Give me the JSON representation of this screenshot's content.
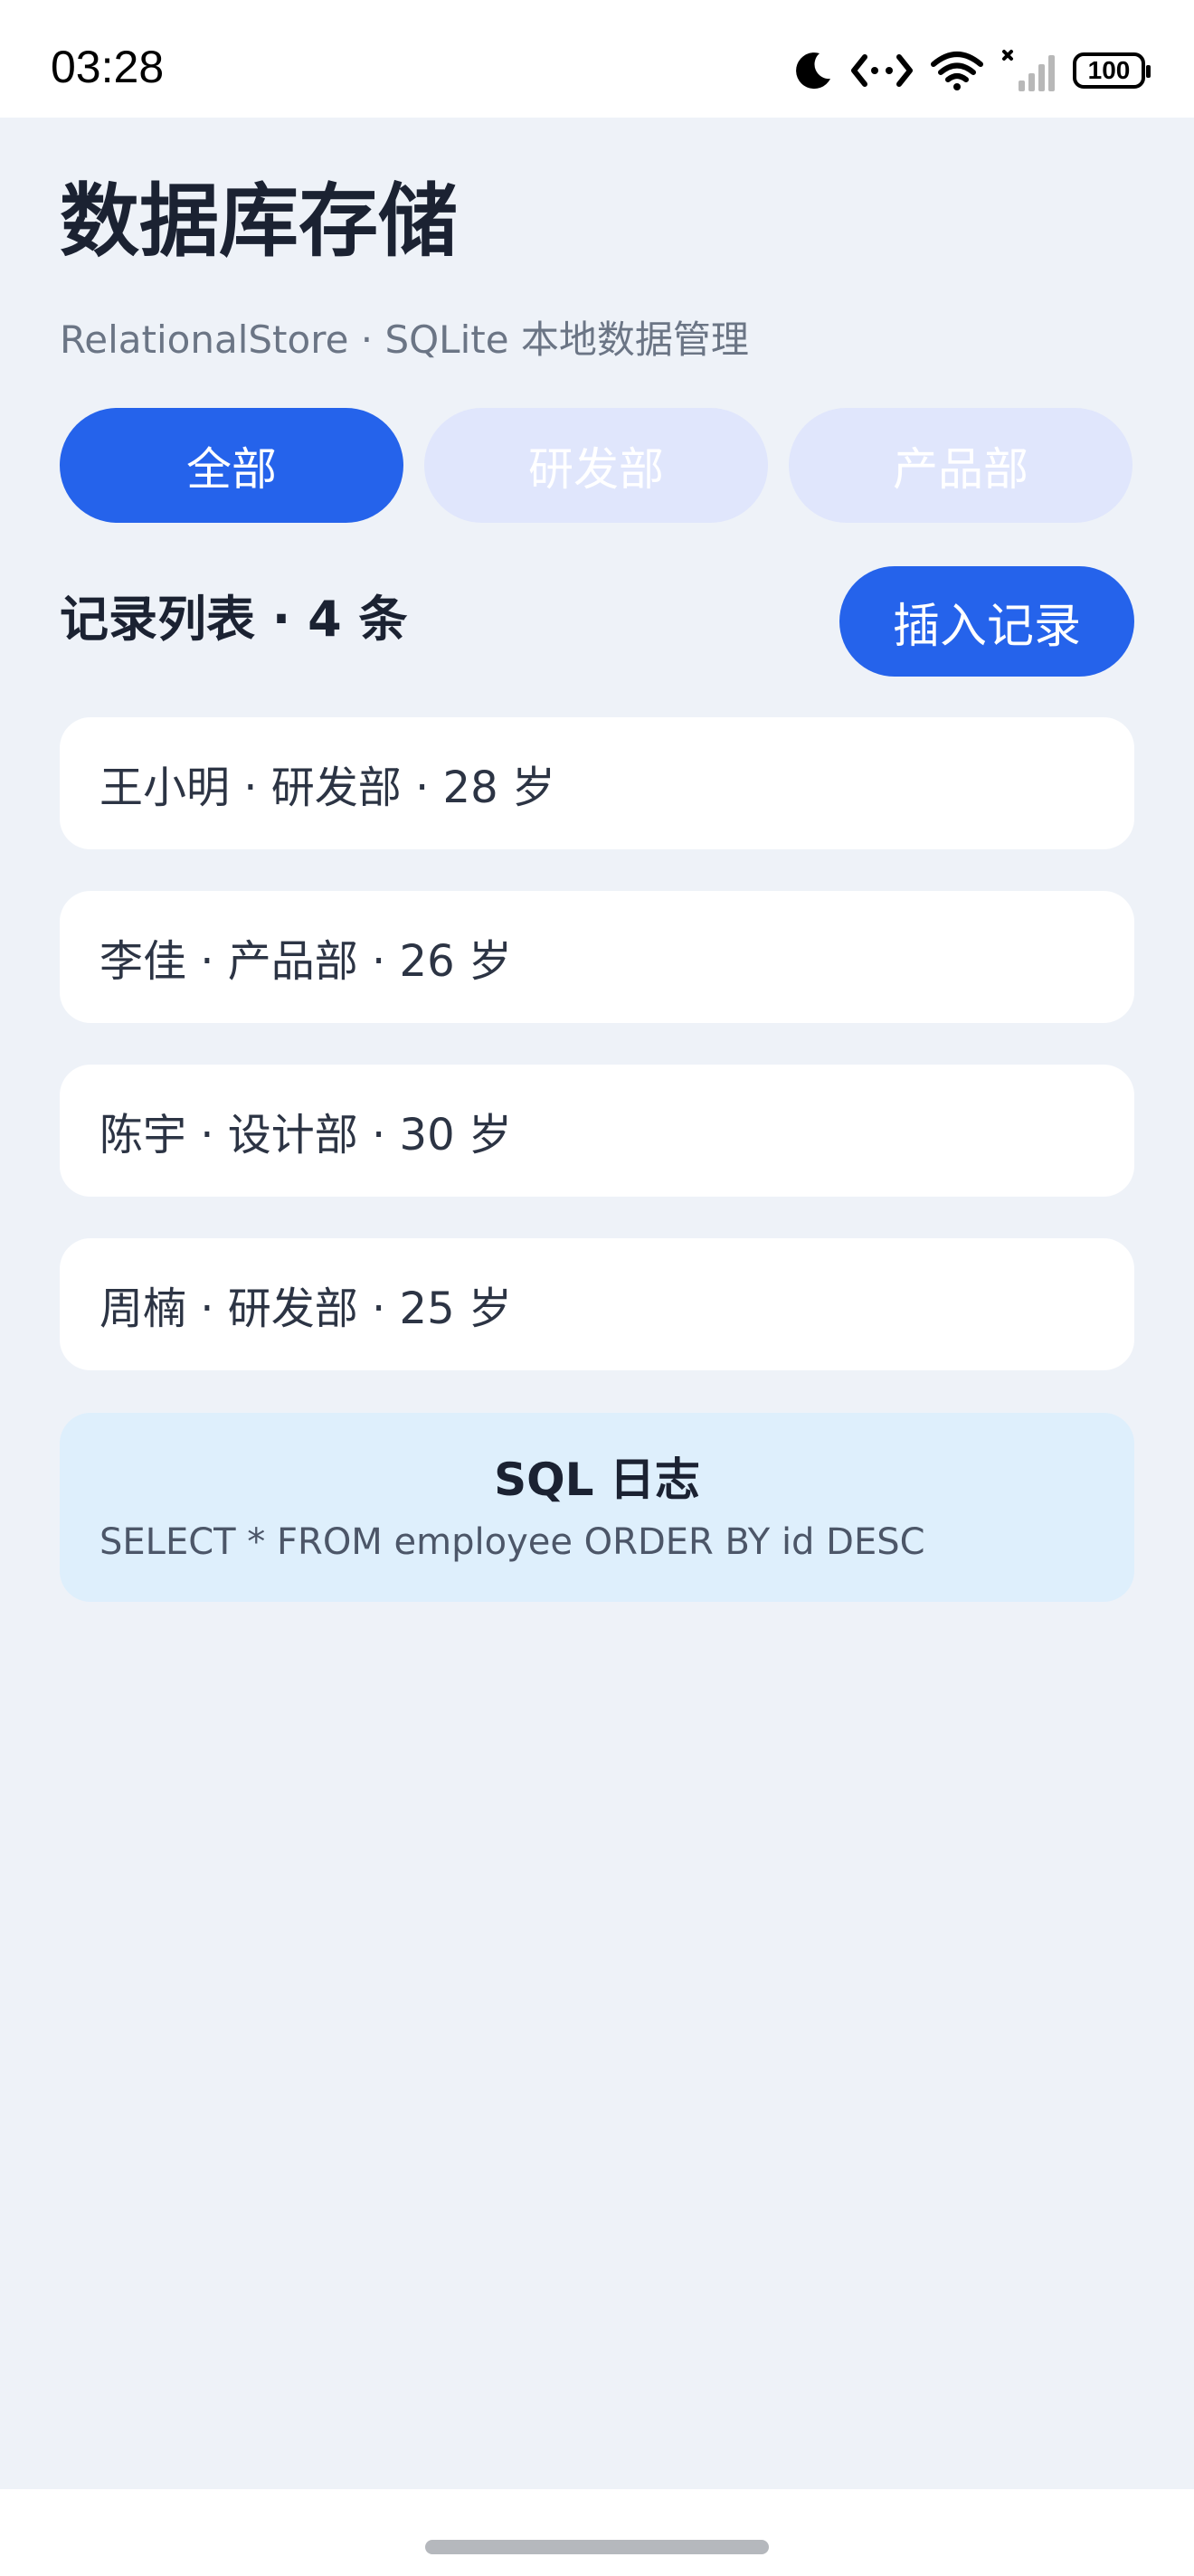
{
  "status_bar": {
    "time": "03:28",
    "battery": "100",
    "icons": [
      "moon-icon",
      "link-icon",
      "wifi-icon",
      "signal-icon",
      "battery-icon"
    ]
  },
  "header": {
    "title": "数据库存储",
    "subtitle": "RelationalStore · SQLite 本地数据管理"
  },
  "tabs": [
    {
      "label": "全部",
      "active": true
    },
    {
      "label": "研发部",
      "active": false
    },
    {
      "label": "产品部",
      "active": false
    }
  ],
  "records_section": {
    "title": "记录列表 · 4 条",
    "insert_label": "插入记录"
  },
  "records": [
    {
      "text": "王小明 · 研发部 · 28 岁"
    },
    {
      "text": "李佳 · 产品部 · 26 岁"
    },
    {
      "text": "陈宇 · 设计部 · 30 岁"
    },
    {
      "text": "周楠 · 研发部 · 25 岁"
    }
  ],
  "sql_log": {
    "title": "SQL 日志",
    "statement": "SELECT * FROM employee ORDER BY id DESC"
  },
  "colors": {
    "accent": "#2563eb",
    "tab_inactive": "#e0e6fc",
    "background": "#eef2f8",
    "log_background": "#deeffc"
  }
}
